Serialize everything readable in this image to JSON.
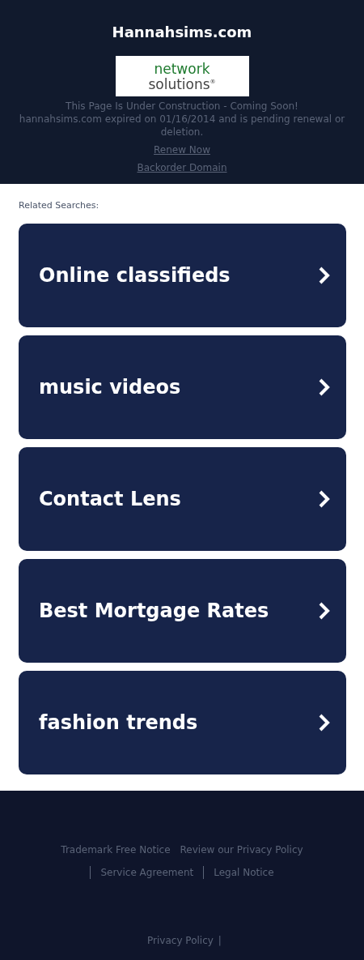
{
  "header": {
    "title": "Hannahsims.com",
    "logo": {
      "line1": "network",
      "line2": "solutions",
      "mark": "®"
    },
    "notice": "This Page Is Under Construction - Coming Soon!",
    "expiry": "hannahsims.com expired on 01/16/2014 and is pending renewal or deletion.",
    "links": [
      "Renew Now",
      "Backorder Domain"
    ]
  },
  "related": {
    "heading": "Related Searches:",
    "items": [
      {
        "label": "Online classifieds"
      },
      {
        "label": "music videos"
      },
      {
        "label": "Contact Lens"
      },
      {
        "label": "Best Mortgage Rates"
      },
      {
        "label": "fashion trends"
      }
    ]
  },
  "footer": {
    "links": [
      {
        "label": "Trademark Free Notice",
        "divider_before": false
      },
      {
        "label": "Review our Privacy Policy",
        "divider_before": false
      },
      {
        "label": "Service Agreement",
        "divider_before": true
      },
      {
        "label": "Legal Notice",
        "divider_before": true
      }
    ],
    "bottom_link": "Privacy Policy",
    "bottom_separator": "|"
  }
}
